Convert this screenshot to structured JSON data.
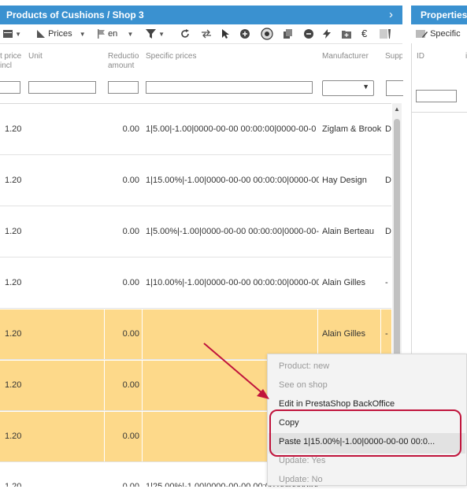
{
  "left_panel": {
    "title": "Products of Cushions / Shop 3",
    "toolbar": {
      "prices_label": "Prices",
      "lang_label": "en"
    },
    "columns": {
      "price_incl": "t price\nincl",
      "unit": "Unit",
      "reduction": "Reductio\namount",
      "specific_prices": "Specific prices",
      "manufacturer": "Manufacturer",
      "supplier": "Supp"
    },
    "rows": [
      {
        "price": "1.20",
        "reduction": "0.00",
        "specific": "1|5.00|-1.00|0000-00-00 00:00:00|0000-00-0",
        "manufacturer": "Ziglam & Brook",
        "supplier": "D"
      },
      {
        "price": "1.20",
        "reduction": "0.00",
        "specific": "1|15.00%|-1.00|0000-00-00 00:00:00|0000-00-0",
        "manufacturer": "Hay Design",
        "supplier": "D"
      },
      {
        "price": "1.20",
        "reduction": "0.00",
        "specific": "1|5.00%|-1.00|0000-00-00 00:00:00|0000-00-0",
        "manufacturer": "Alain Berteau",
        "supplier": "D"
      },
      {
        "price": "1.20",
        "reduction": "0.00",
        "specific": "1|10.00%|-1.00|0000-00-00 00:00:00|0000-00-0",
        "manufacturer": "Alain Gilles",
        "supplier": "-"
      },
      {
        "price": "1.20",
        "reduction": "0.00",
        "specific": "",
        "manufacturer": "Alain Gilles",
        "supplier": "-"
      },
      {
        "price": "1.20",
        "reduction": "0.00",
        "specific": "",
        "manufacturer": "",
        "supplier": ""
      },
      {
        "price": "1.20",
        "reduction": "0.00",
        "specific": "",
        "manufacturer": "",
        "supplier": ""
      },
      {
        "price": "1.20",
        "reduction": "0.00",
        "specific": "1|25.00%|-1.00|0000-00-00 00:00:00|0000-00-0",
        "manufacturer": "",
        "supplier": ""
      }
    ]
  },
  "right_panel": {
    "title": "Properties",
    "toolbar_label": "Specific",
    "columns": {
      "id": "ID"
    }
  },
  "context_menu": {
    "items": [
      {
        "label": "Product: new",
        "enabled": false
      },
      {
        "label": "See on shop",
        "enabled": false
      },
      {
        "label": "Edit in PrestaShop BackOffice",
        "enabled": true
      },
      {
        "label": "Copy",
        "enabled": true
      },
      {
        "label": "Paste 1|15.00%|-1.00|0000-00-00 00:0...",
        "enabled": true
      },
      {
        "label": "Update: Yes",
        "enabled": false
      },
      {
        "label": "Update: No",
        "enabled": false
      }
    ]
  },
  "colors": {
    "header_blue": "#3a91d0",
    "highlight_row": "#fdd98a",
    "annotation_red": "#c0143c"
  }
}
